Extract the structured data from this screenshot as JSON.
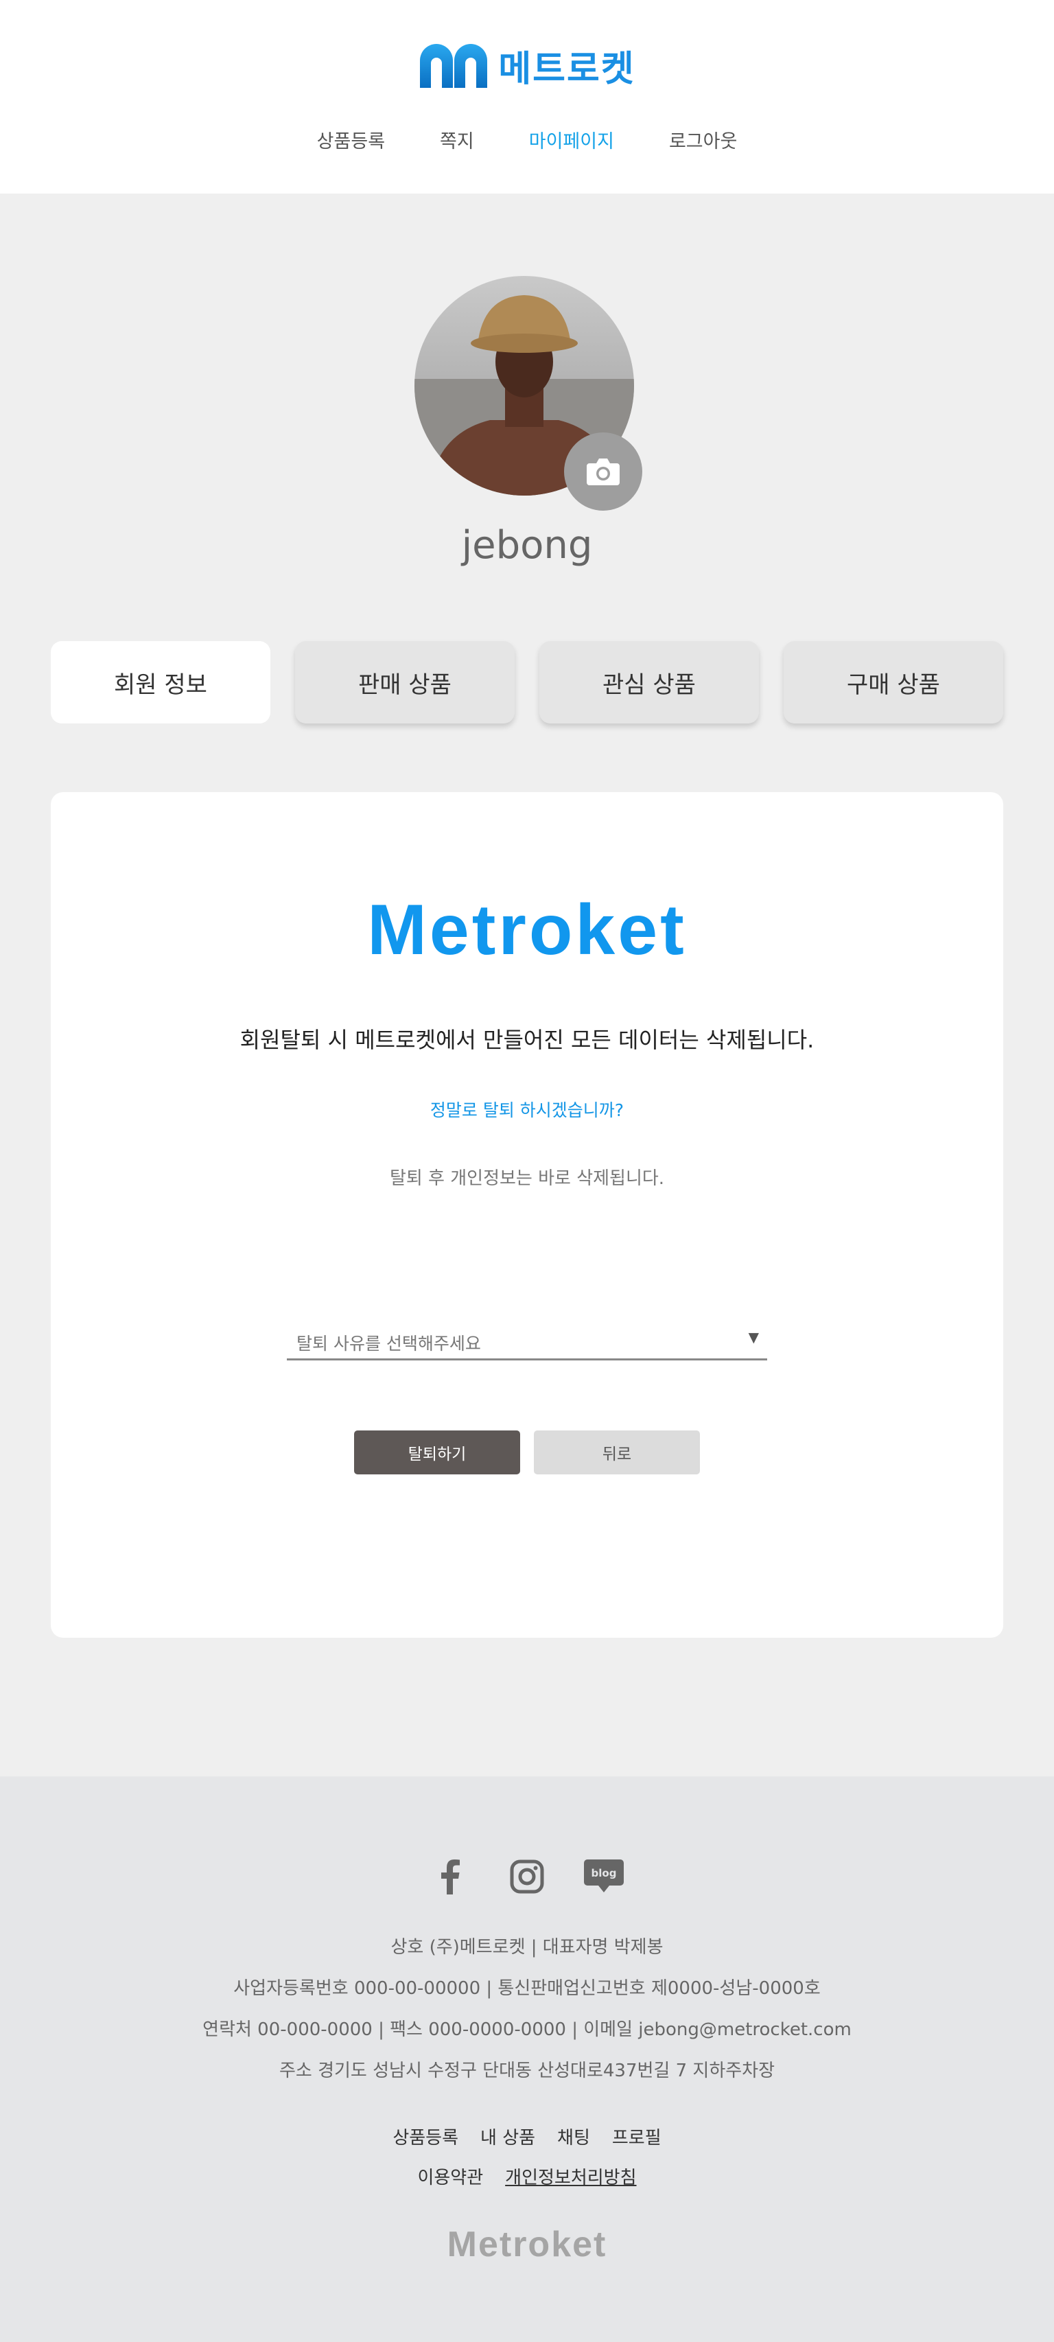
{
  "header": {
    "logo_text": "메트로켓",
    "nav": [
      "상품등록",
      "쪽지",
      "마이페이지",
      "로그아웃"
    ],
    "active_nav": "마이페이지"
  },
  "profile": {
    "username": "jebong",
    "camera_icon": "camera-icon"
  },
  "tabs": [
    "회원 정보",
    "판매 상품",
    "관심 상품",
    "구매 상품"
  ],
  "withdraw": {
    "brand": "Metroket",
    "warning": "회원탈퇴 시 메트로켓에서 만들어진 모든 데이터는 삭제됩니다.",
    "question": "정말로 탈퇴 하시겠습니까?",
    "notice": "탈퇴 후 개인정보는 바로 삭제됩니다.",
    "reason_placeholder": "탈퇴 사유를 선택해주세요",
    "submit_label": "탈퇴하기",
    "back_label": "뒤로"
  },
  "footer": {
    "social": [
      "facebook-icon",
      "instagram-icon",
      "blog-icon"
    ],
    "blog_text": "blog",
    "line1": "상호 (주)메트로켓  | 대표자명 박제봉",
    "line2": "사업자등록번호 000-00-00000  | 통신판매업신고번호 제0000-성남-0000호",
    "line3": "연락처 00-000-0000 | 팩스 000-0000-0000 | 이메일 jebong@metrocket.com",
    "line4": "주소 경기도 성남시 수정구 단대동 산성대로437번길 7  지하주차장",
    "links_row1": [
      "상품등록",
      "내 상품",
      "채팅",
      "프로필"
    ],
    "links_row2": [
      "이용약관",
      "개인정보처리방침"
    ],
    "brand": "Metroket"
  },
  "colors": {
    "accent": "#1497e8",
    "page_bg": "#efefef",
    "footer_bg": "#e5e6e8",
    "withdraw_button": "#5e5856"
  }
}
